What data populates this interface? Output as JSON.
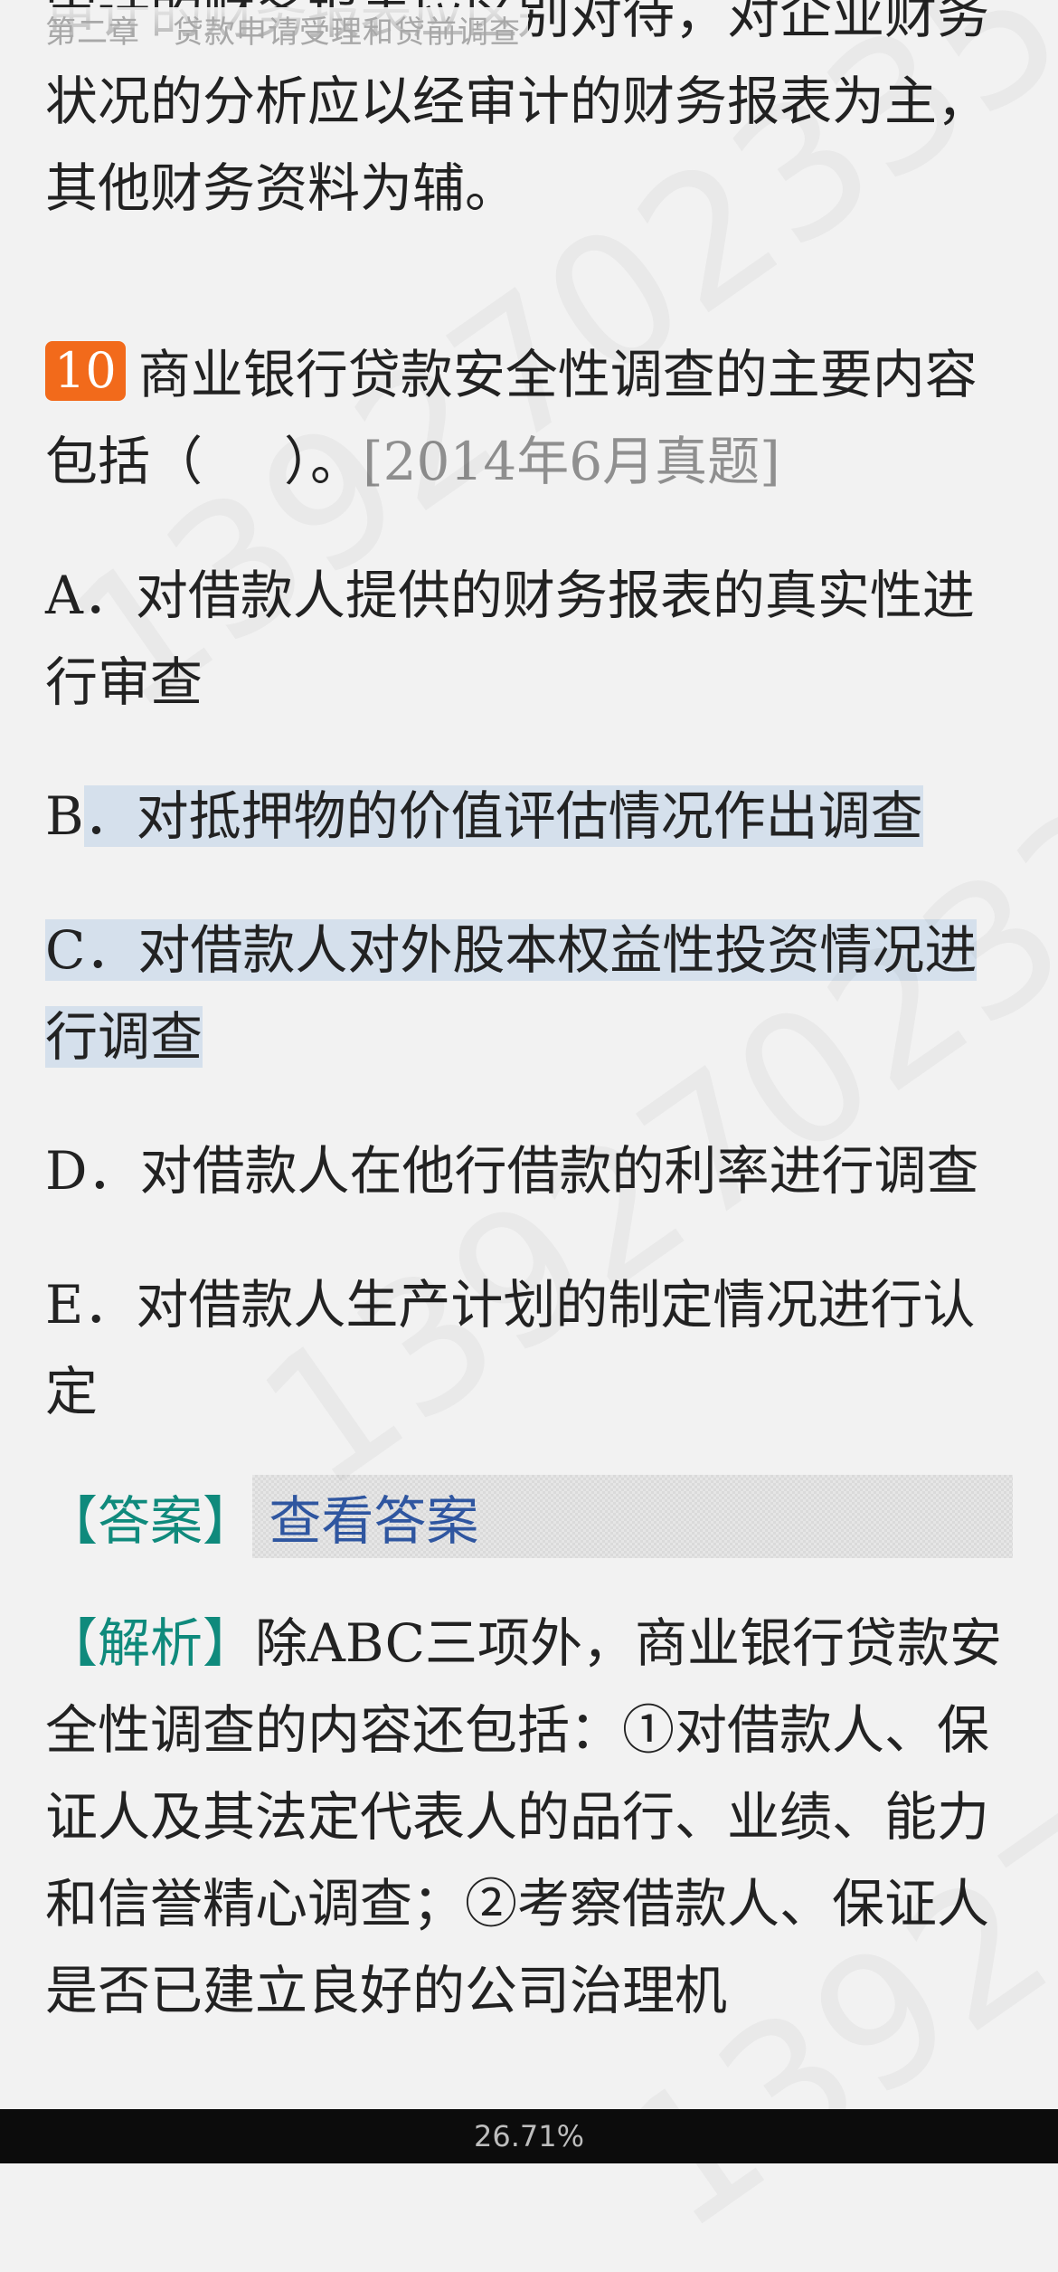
{
  "header": {
    "chapter": "第二章",
    "section": "贷款申请受理和贷前调查"
  },
  "content": {
    "prev_paragraph": "审计的财务报表应区别对待，对企业财务状况的分析应以经审计的财务报表为主，其他财务资料为辅。",
    "question": {
      "number": "10",
      "stem": "商业银行贷款安全性调查的主要内容包括（",
      "stem_close": "）。",
      "source": "[2014年6月真题]"
    },
    "options": [
      {
        "letter": "A",
        "text": "对借款人提供的财务报表的真实性进行审查"
      },
      {
        "letter": "B",
        "text": "对抵押物的价值评估情况作出调查"
      },
      {
        "letter": "C",
        "text": "对借款人对外股本权益性投资情况进行调查"
      },
      {
        "letter": "D",
        "text": "对借款人在他行借款的利率进行调查"
      },
      {
        "letter": "E",
        "text": "对借款人生产计划的制定情况进行认定"
      }
    ],
    "answer": {
      "label": "【答案】",
      "reveal": "查看答案"
    },
    "analysis": {
      "label": "【解析】",
      "text": "除ABC三项外，商业银行贷款安全性调查的内容还包括：①对借款人、保证人及其法定代表人的品行、业绩、能力和信誉精心调查；②考察借款人、保证人是否已建立良好的公司治理机"
    }
  },
  "watermark": "13927023355",
  "status": {
    "progress": "26.71%"
  }
}
